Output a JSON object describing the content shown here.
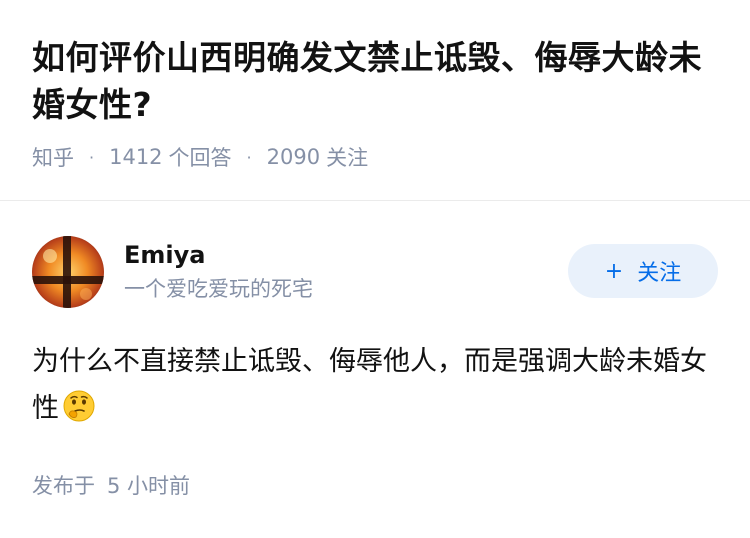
{
  "question": {
    "title": "如何评价山西明确发文禁止诋毁、侮辱大龄未婚女性?",
    "source": "知乎",
    "answers_count": "1412",
    "answers_label": "个回答",
    "followers_count": "2090",
    "followers_label": "关注",
    "separator": "·"
  },
  "answer": {
    "author": {
      "name": "Emiya",
      "bio": "一个爱吃爱玩的死宅",
      "avatar_icon": "avatar-fire-window-icon"
    },
    "follow_button": {
      "plus": "+",
      "label": "关注"
    },
    "content": "为什么不直接禁止诋毁、侮辱他人，而是强调大龄未婚女性",
    "emoji_icon": "thinking-face-icon",
    "time_prefix": "发布于",
    "time_value": "5 小时前"
  },
  "colors": {
    "text_primary": "#121212",
    "text_secondary": "#8590a6",
    "accent": "#056de8",
    "follow_bg": "#e9f1fb"
  }
}
